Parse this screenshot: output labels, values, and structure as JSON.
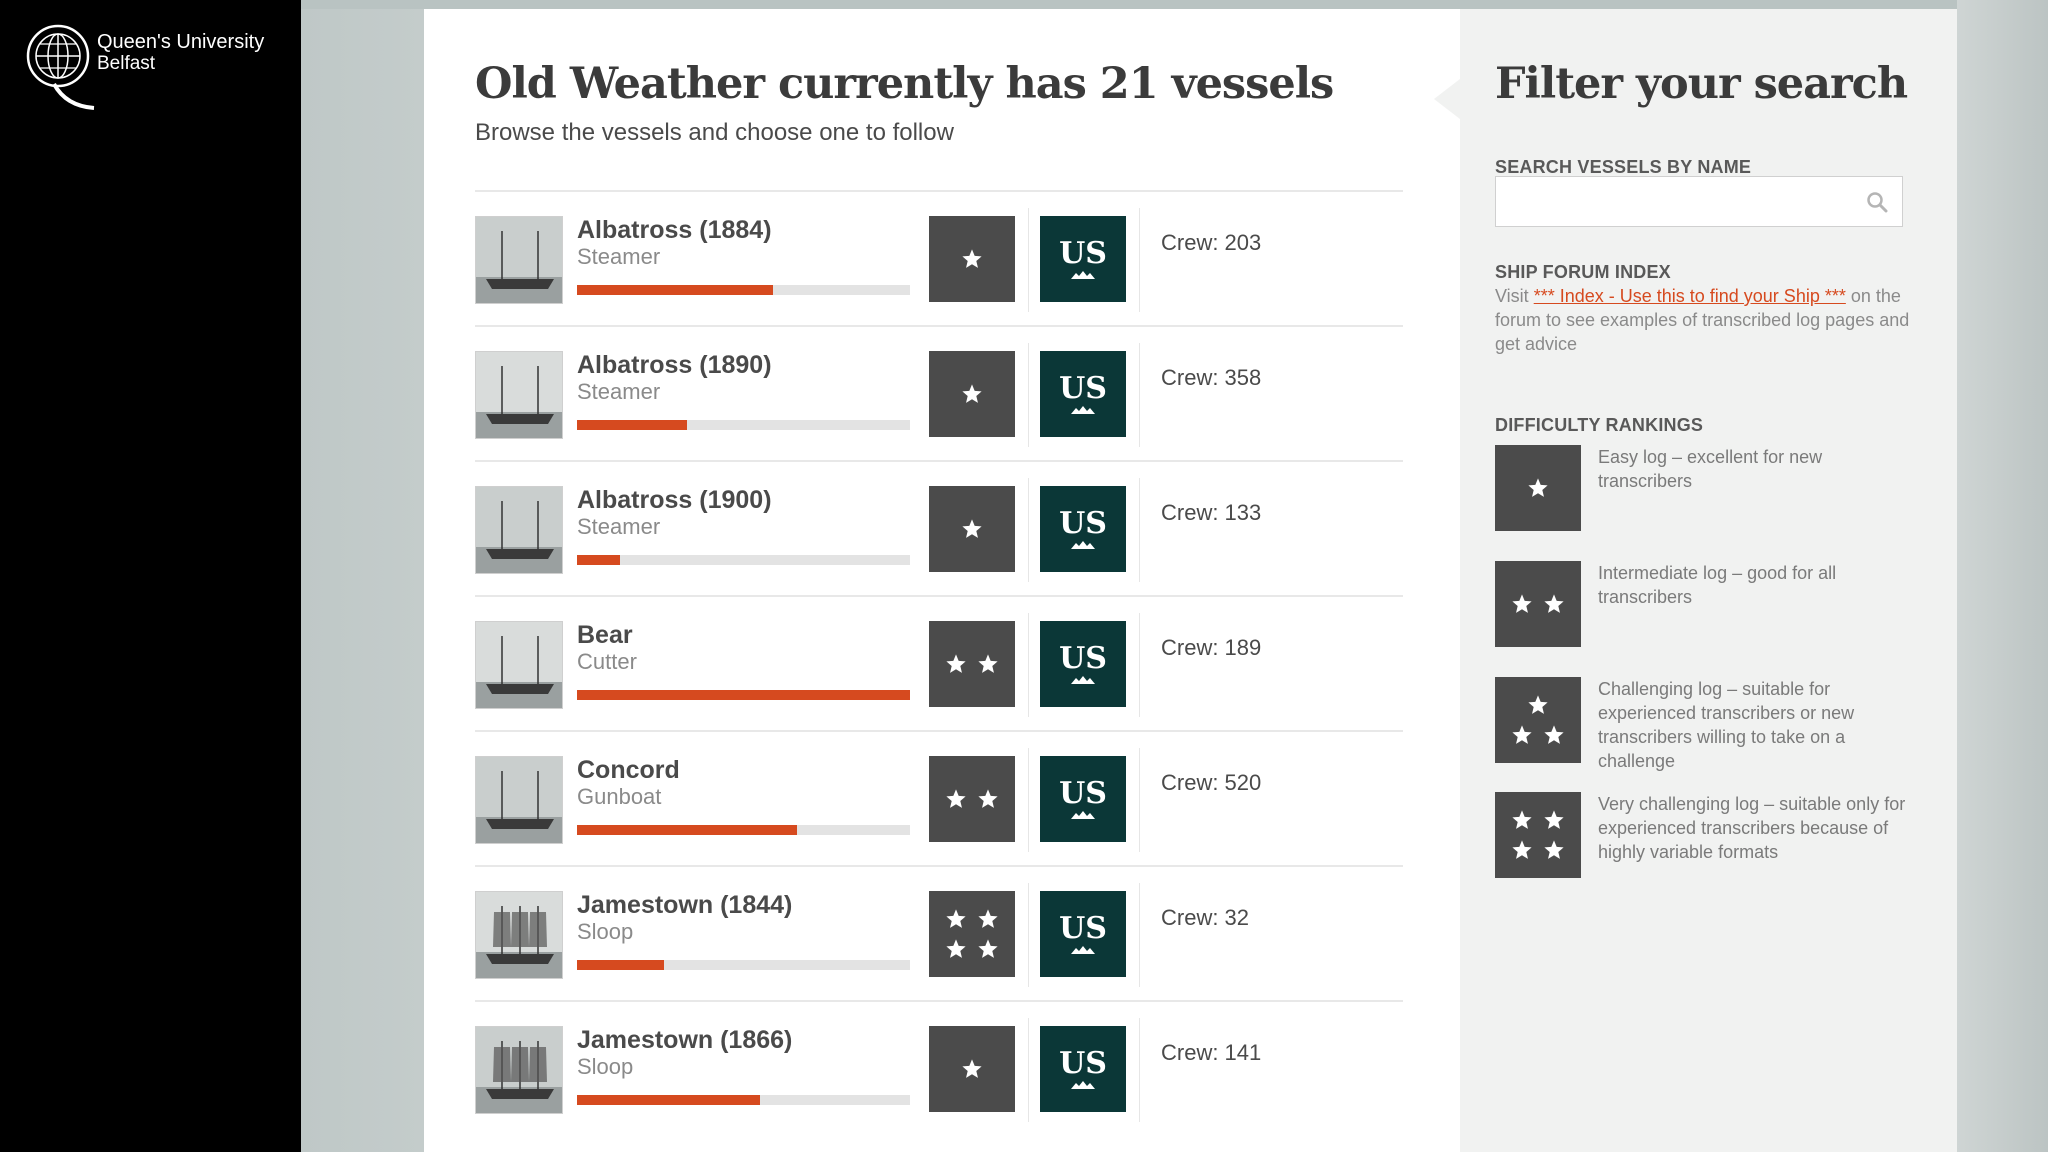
{
  "logo": {
    "name": "Queen's University",
    "sub": "Belfast"
  },
  "page": {
    "title": "Old Weather currently has 21 vessels",
    "subtitle": "Browse the vessels and choose one to follow"
  },
  "vessels": [
    {
      "name": "Albatross (1884)",
      "type": "Steamer",
      "progress": 0.59,
      "stars": 1,
      "flag": "US",
      "crew": "Crew: 203"
    },
    {
      "name": "Albatross (1890)",
      "type": "Steamer",
      "progress": 0.33,
      "stars": 1,
      "flag": "US",
      "crew": "Crew: 358"
    },
    {
      "name": "Albatross (1900)",
      "type": "Steamer",
      "progress": 0.13,
      "stars": 1,
      "flag": "US",
      "crew": "Crew: 133"
    },
    {
      "name": "Bear",
      "type": "Cutter",
      "progress": 1.0,
      "stars": 2,
      "flag": "US",
      "crew": "Crew: 189"
    },
    {
      "name": "Concord",
      "type": "Gunboat",
      "progress": 0.66,
      "stars": 2,
      "flag": "US",
      "crew": "Crew: 520"
    },
    {
      "name": "Jamestown (1844)",
      "type": "Sloop",
      "progress": 0.26,
      "stars": 4,
      "flag": "US",
      "crew": "Crew: 32"
    },
    {
      "name": "Jamestown (1866)",
      "type": "Sloop",
      "progress": 0.55,
      "stars": 1,
      "flag": "US",
      "crew": "Crew: 141"
    }
  ],
  "sidebar": {
    "title": "Filter your search",
    "search_heading": "SEARCH VESSELS BY NAME",
    "search_value": "",
    "forum_heading": "SHIP FORUM INDEX",
    "forum_prefix": "Visit ",
    "forum_link": "*** Index - Use this to find your Ship ***",
    "forum_suffix": " on the forum to see examples of transcribed log pages and get advice",
    "difficulty_heading": "DIFFICULTY RANKINGS",
    "rankings": [
      {
        "stars": 1,
        "text": "Easy log – excellent for new transcribers"
      },
      {
        "stars": 2,
        "text": "Intermediate log – good for all transcribers"
      },
      {
        "stars": 3,
        "text": "Challenging log – suitable for experienced transcribers or new transcribers willing to take on a challenge"
      },
      {
        "stars": 4,
        "text": "Very challenging log – suitable only for experienced transcribers because of highly variable formats"
      }
    ]
  },
  "colors": {
    "accent": "#d64a1f",
    "flag_bg": "#0b3737",
    "badge_bg": "#4b4b4b"
  },
  "icons": {
    "search": "search-icon",
    "star": "star-icon",
    "flag": "us-flag-icon"
  }
}
